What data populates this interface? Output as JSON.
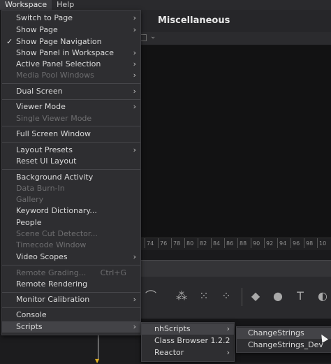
{
  "menubar": {
    "items": [
      "Workspace",
      "Help"
    ]
  },
  "background": {
    "title": "Miscellaneous",
    "ruler_ticks": [
      "74",
      "76",
      "78",
      "80",
      "82",
      "84",
      "86",
      "88",
      "90",
      "92",
      "94",
      "96",
      "98",
      "10"
    ]
  },
  "workspace_menu": {
    "items": [
      {
        "label": "Switch to Page",
        "submenu": true,
        "enabled": true
      },
      {
        "label": "Show Page",
        "submenu": true,
        "enabled": true
      },
      {
        "label": "Show Page Navigation",
        "checked": true,
        "enabled": true
      },
      {
        "label": "Show Panel in Workspace",
        "submenu": true,
        "enabled": true
      },
      {
        "label": "Active Panel Selection",
        "submenu": true,
        "enabled": true
      },
      {
        "label": "Media Pool Windows",
        "submenu": true,
        "enabled": false
      },
      {
        "label": "Dual Screen",
        "submenu": true,
        "enabled": true
      },
      {
        "label": "Viewer Mode",
        "submenu": true,
        "enabled": true
      },
      {
        "label": "Single Viewer Mode",
        "enabled": false
      },
      {
        "label": "Full Screen Window",
        "enabled": true
      },
      {
        "label": "Layout Presets",
        "submenu": true,
        "enabled": true
      },
      {
        "label": "Reset UI Layout",
        "enabled": true
      },
      {
        "label": "Background Activity",
        "enabled": true
      },
      {
        "label": "Data Burn-In",
        "enabled": false
      },
      {
        "label": "Gallery",
        "enabled": false
      },
      {
        "label": "Keyword Dictionary...",
        "enabled": true
      },
      {
        "label": "People",
        "enabled": true
      },
      {
        "label": "Scene Cut Detector...",
        "enabled": false
      },
      {
        "label": "Timecode Window",
        "enabled": false
      },
      {
        "label": "Video Scopes",
        "submenu": true,
        "enabled": true
      },
      {
        "label": "Remote Grading...",
        "shortcut": "Ctrl+G",
        "enabled": false
      },
      {
        "label": "Remote Rendering",
        "enabled": true
      },
      {
        "label": "Monitor Calibration",
        "submenu": true,
        "enabled": true
      },
      {
        "label": "Console",
        "enabled": true
      },
      {
        "label": "Scripts",
        "submenu": true,
        "enabled": true,
        "highlighted": true
      }
    ]
  },
  "scripts_menu": {
    "items": [
      {
        "label": "nhScripts",
        "submenu": true,
        "enabled": true,
        "highlighted": true
      },
      {
        "label": "Class Browser 1.2.2",
        "enabled": true
      },
      {
        "label": "Reactor",
        "submenu": true,
        "enabled": true
      }
    ]
  },
  "nhscripts_menu": {
    "items": [
      {
        "label": "ChangeStrings",
        "enabled": true,
        "highlighted": true
      },
      {
        "label": "ChangeStrings_Dev",
        "enabled": true
      }
    ]
  }
}
